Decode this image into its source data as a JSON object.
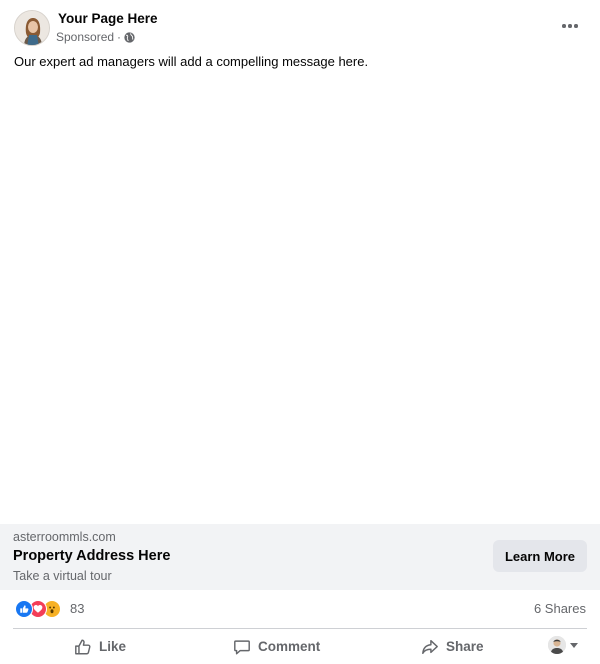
{
  "header": {
    "page_name": "Your Page Here",
    "sponsored_label": "Sponsored",
    "separator": "·",
    "avatar_icon": "profile-photo-icon",
    "audience_icon": "globe-icon",
    "more_icon": "more-options-icon"
  },
  "post": {
    "message": "Our expert ad managers will add a compelling message here."
  },
  "link_preview": {
    "domain": "asterroommls.com",
    "title": "Property Address Here",
    "description": "Take a virtual tour",
    "cta_label": "Learn More"
  },
  "engagement": {
    "reaction_icons": [
      "like-reaction-icon",
      "love-reaction-icon",
      "wow-reaction-icon"
    ],
    "reaction_count": "83",
    "shares_label": "6 Shares"
  },
  "actions": {
    "like_label": "Like",
    "comment_label": "Comment",
    "share_label": "Share"
  },
  "colors": {
    "text_primary": "#050505",
    "text_secondary": "#65676b",
    "link_bar_bg": "#f2f3f5",
    "button_bg": "#e4e6eb",
    "like_blue": "#1877f2",
    "love_red": "#f33e58",
    "wow_yellow": "#f7b125"
  }
}
